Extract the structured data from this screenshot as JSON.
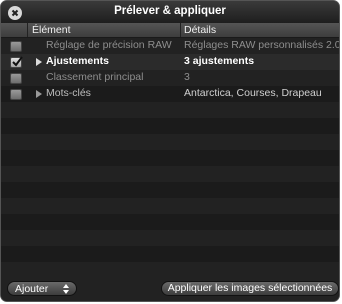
{
  "window": {
    "title": "Prélever & appliquer"
  },
  "table": {
    "columns": [
      "Élément",
      "Détails"
    ],
    "rows": [
      {
        "checked": false,
        "expandable": false,
        "element": "Réglage de précision RAW",
        "details": "Réglages RAW personnalisés 2.0",
        "emphasis": "dim"
      },
      {
        "checked": true,
        "expandable": true,
        "element": "Ajustements",
        "details": "3 ajustements",
        "emphasis": "bold"
      },
      {
        "checked": false,
        "expandable": false,
        "element": "Classement principal",
        "details": "3",
        "emphasis": "dim"
      },
      {
        "checked": false,
        "expandable": true,
        "element": "Mots-clés",
        "details": "Antarctica, Courses, Drapeau",
        "emphasis": "normal"
      }
    ]
  },
  "footer": {
    "add_popup_label": "Ajouter",
    "apply_button_label": "Appliquer les images sélectionnées"
  },
  "colors": {
    "background": "#222222",
    "text_bright": "#ffffff",
    "text_dim": "#8e8e8e"
  }
}
